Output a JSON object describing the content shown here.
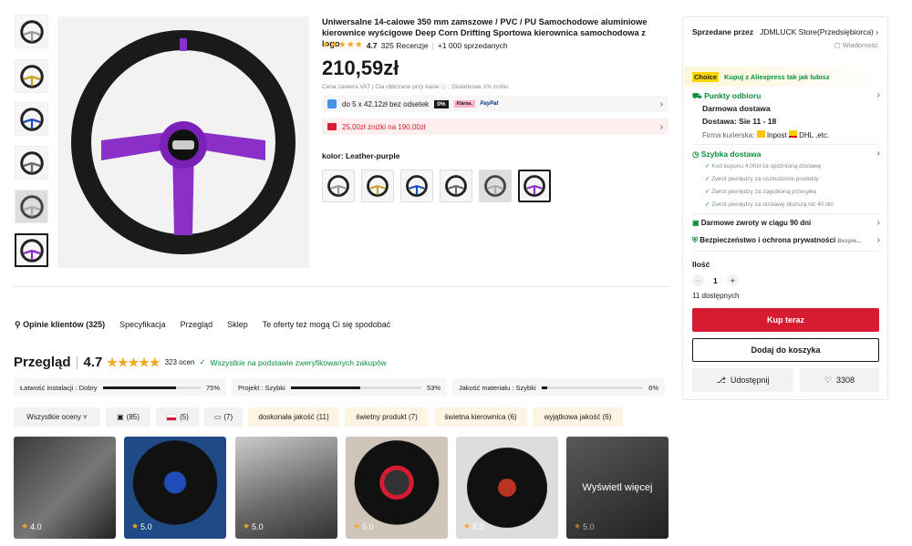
{
  "product": {
    "title": "Uniwersalne 14-calowe 350 mm zamszowe / PVC / PU Samochodowe aluminiowe kierownice wyścigowe Deep Corn Drifting Sportowa kierownica samochodowa z logo",
    "stars": "★★★★★",
    "rating": "4.7",
    "reviews": "325 Recenzje",
    "sold": "+1 000 sprzedanych",
    "price": "210,59zł",
    "vat_note": "Cena zawiera VAT | Cła obliczane przy kasie ⓘ ; Dodatkowe 1% zniżki",
    "installment": "do 5 x 42,12zł bez odsetek",
    "installment_badge": "0%",
    "klarna": "Klarna.",
    "paypal": "PayPal",
    "coupon": "25,00zł zniżki na 190,00zł",
    "color_label": "kolor: Leather-purple"
  },
  "colors": {
    "accent": "#d71c31",
    "purple": "#8b2fc9",
    "green": "#0a8f3c",
    "star": "#f5a623"
  },
  "nav": {
    "reviews": "Opinie klientów (325)",
    "specs": "Specyfikacja",
    "overview": "Przegląd",
    "store": "Sklep",
    "recommend": "Te oferty też mogą Ci się spodobać"
  },
  "review": {
    "heading": "Przegląd",
    "score": "4.7",
    "stars": "★★★★★",
    "count": "323 ocen",
    "verified": "Wszystkie na podstawie zweryfikowanych zakupów",
    "bars": [
      {
        "label": "Łatwość instalacji : Dobry",
        "pct": "75%",
        "value": 0.75
      },
      {
        "label": "Projekt : Szybki",
        "pct": "53%",
        "value": 0.53
      },
      {
        "label": "Jakość materiału : Szybki",
        "pct": "6%",
        "value": 0.06
      }
    ],
    "filters": {
      "all": "Wszystkie oceny ˅",
      "photos": "(85)",
      "flag": "(5)",
      "comments": "(7)",
      "t1": "doskonała jakość (11)",
      "t2": "świetny produkt (7)",
      "t3": "świetna kierownica (6)",
      "t4": "wyjątkowa jakość (6)"
    },
    "images": [
      {
        "score": "4.0"
      },
      {
        "score": "5.0"
      },
      {
        "score": "5.0"
      },
      {
        "score": "5.0"
      },
      {
        "score": "5.0"
      },
      {
        "score": "5.0"
      }
    ],
    "more": "Wyświetl więcej"
  },
  "panel": {
    "seller_label": "Sprzedane przez",
    "seller": "JDMLUCK Store(Przedsiębiorca) ›",
    "message": "▢ Wiadomość",
    "choice": "Choice",
    "choice_text": "Kupuj z Aliexpress tak jak lubisz",
    "pickup": "Punkty odbioru",
    "free_delivery": "Darmowa dostawa",
    "delivery": "Dostawa: Sie 11 - 18",
    "courier_label": "Firma kurierska:",
    "courier1": "Inpost",
    "courier2": "DHL ,etc.",
    "fast": "Szybka dostawa",
    "fast_items": [
      "Kod kuponu 4,00zł za spóźnioną dostawę",
      "Zwrot pieniędzy za uszkodzone produkty",
      "Zwrot pieniędzy za zagubioną przesyłkę",
      "Zwrot pieniędzy za dostawę dłuższą niż 40 dni"
    ],
    "returns": "Darmowe zwroty w ciągu 90 dni",
    "security": "Bezpieczeństwo i ochrona prywatności",
    "security_more": "Bezpie...",
    "qty_label": "Ilość",
    "qty": "1",
    "available": "11 dostępnych",
    "buy": "Kup teraz",
    "cart": "Dodaj do koszyka",
    "share": "Udostępnij",
    "likes": "3308"
  }
}
